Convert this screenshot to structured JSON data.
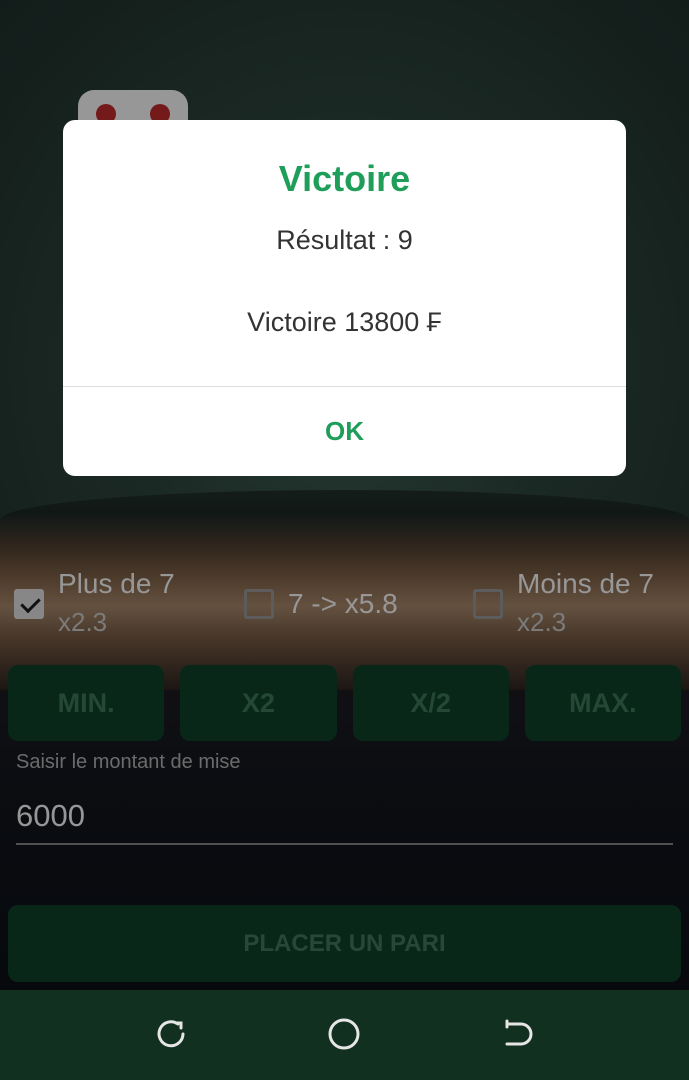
{
  "bet_options": [
    {
      "label": "Plus de 7",
      "multiplier": "x2.3",
      "checked": true
    },
    {
      "label": "7 -> x5.8",
      "multiplier": "",
      "checked": false
    },
    {
      "label": "Moins de 7",
      "multiplier": "x2.3",
      "checked": false
    }
  ],
  "quick_buttons": {
    "min": "MIN.",
    "double": "X2",
    "half": "X/2",
    "max": "MAX."
  },
  "amount": {
    "label": "Saisir le montant de mise",
    "value": "6000"
  },
  "place_bet": "PLACER UN PARI",
  "dialog": {
    "title": "Victoire",
    "result": "Résultat : 9",
    "win": "Victoire 13800 ₣",
    "ok": "OK"
  },
  "navbar": {
    "icons": [
      "back-icon",
      "home-icon",
      "recent-apps-icon"
    ]
  },
  "colors": {
    "accent_green": "#1f9e5a",
    "button_bg": "#0f3d27",
    "navbar_bg": "#12301f"
  }
}
